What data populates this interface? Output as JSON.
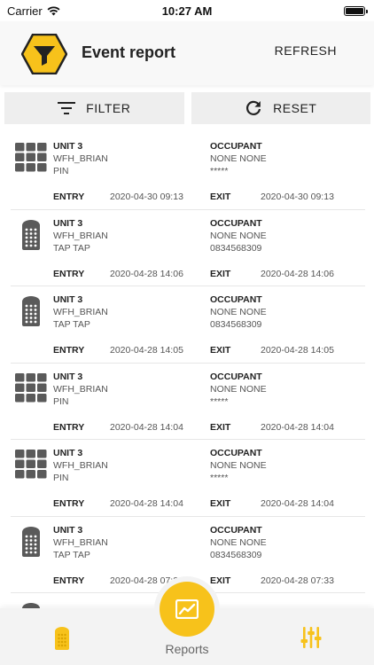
{
  "status_bar": {
    "carrier": "Carrier",
    "time": "10:27 AM"
  },
  "header": {
    "title": "Event report",
    "refresh_label": "REFRESH"
  },
  "actions": {
    "filter_label": "FILTER",
    "reset_label": "RESET"
  },
  "labels": {
    "occupant": "OCCUPANT",
    "entry": "ENTRY",
    "exit": "EXIT"
  },
  "colors": {
    "brand_yellow": "#f7c21b",
    "icon_gray": "#5a5a5a"
  },
  "events": [
    {
      "icon": "keypad-icon",
      "unit": "UNIT 3",
      "user": "WFH_BRIAN",
      "method": "PIN",
      "occupant": "NONE NONE",
      "credential": "*****",
      "entry": "2020-04-30 09:13",
      "exit": "2020-04-30 09:13"
    },
    {
      "icon": "remote-icon",
      "unit": "UNIT 3",
      "user": "WFH_BRIAN",
      "method": "TAP TAP",
      "occupant": "NONE NONE",
      "credential": "0834568309",
      "entry": "2020-04-28 14:06",
      "exit": "2020-04-28 14:06"
    },
    {
      "icon": "remote-icon",
      "unit": "UNIT 3",
      "user": "WFH_BRIAN",
      "method": "TAP TAP",
      "occupant": "NONE NONE",
      "credential": "0834568309",
      "entry": "2020-04-28 14:05",
      "exit": "2020-04-28 14:05"
    },
    {
      "icon": "keypad-icon",
      "unit": "UNIT 3",
      "user": "WFH_BRIAN",
      "method": "PIN",
      "occupant": "NONE NONE",
      "credential": "*****",
      "entry": "2020-04-28 14:04",
      "exit": "2020-04-28 14:04"
    },
    {
      "icon": "keypad-icon",
      "unit": "UNIT 3",
      "user": "WFH_BRIAN",
      "method": "PIN",
      "occupant": "NONE NONE",
      "credential": "*****",
      "entry": "2020-04-28 14:04",
      "exit": "2020-04-28 14:04"
    },
    {
      "icon": "remote-icon",
      "unit": "UNIT 3",
      "user": "WFH_BRIAN",
      "method": "TAP TAP",
      "occupant": "NONE NONE",
      "credential": "0834568309",
      "entry": "2020-04-28 07:33",
      "exit": "2020-04-28 07:33"
    },
    {
      "icon": "remote-icon",
      "unit": "",
      "user": "",
      "method": "",
      "occupant": "",
      "credential": "",
      "entry": "",
      "exit": ""
    }
  ],
  "tab_bar": {
    "reports_label": "Reports"
  }
}
